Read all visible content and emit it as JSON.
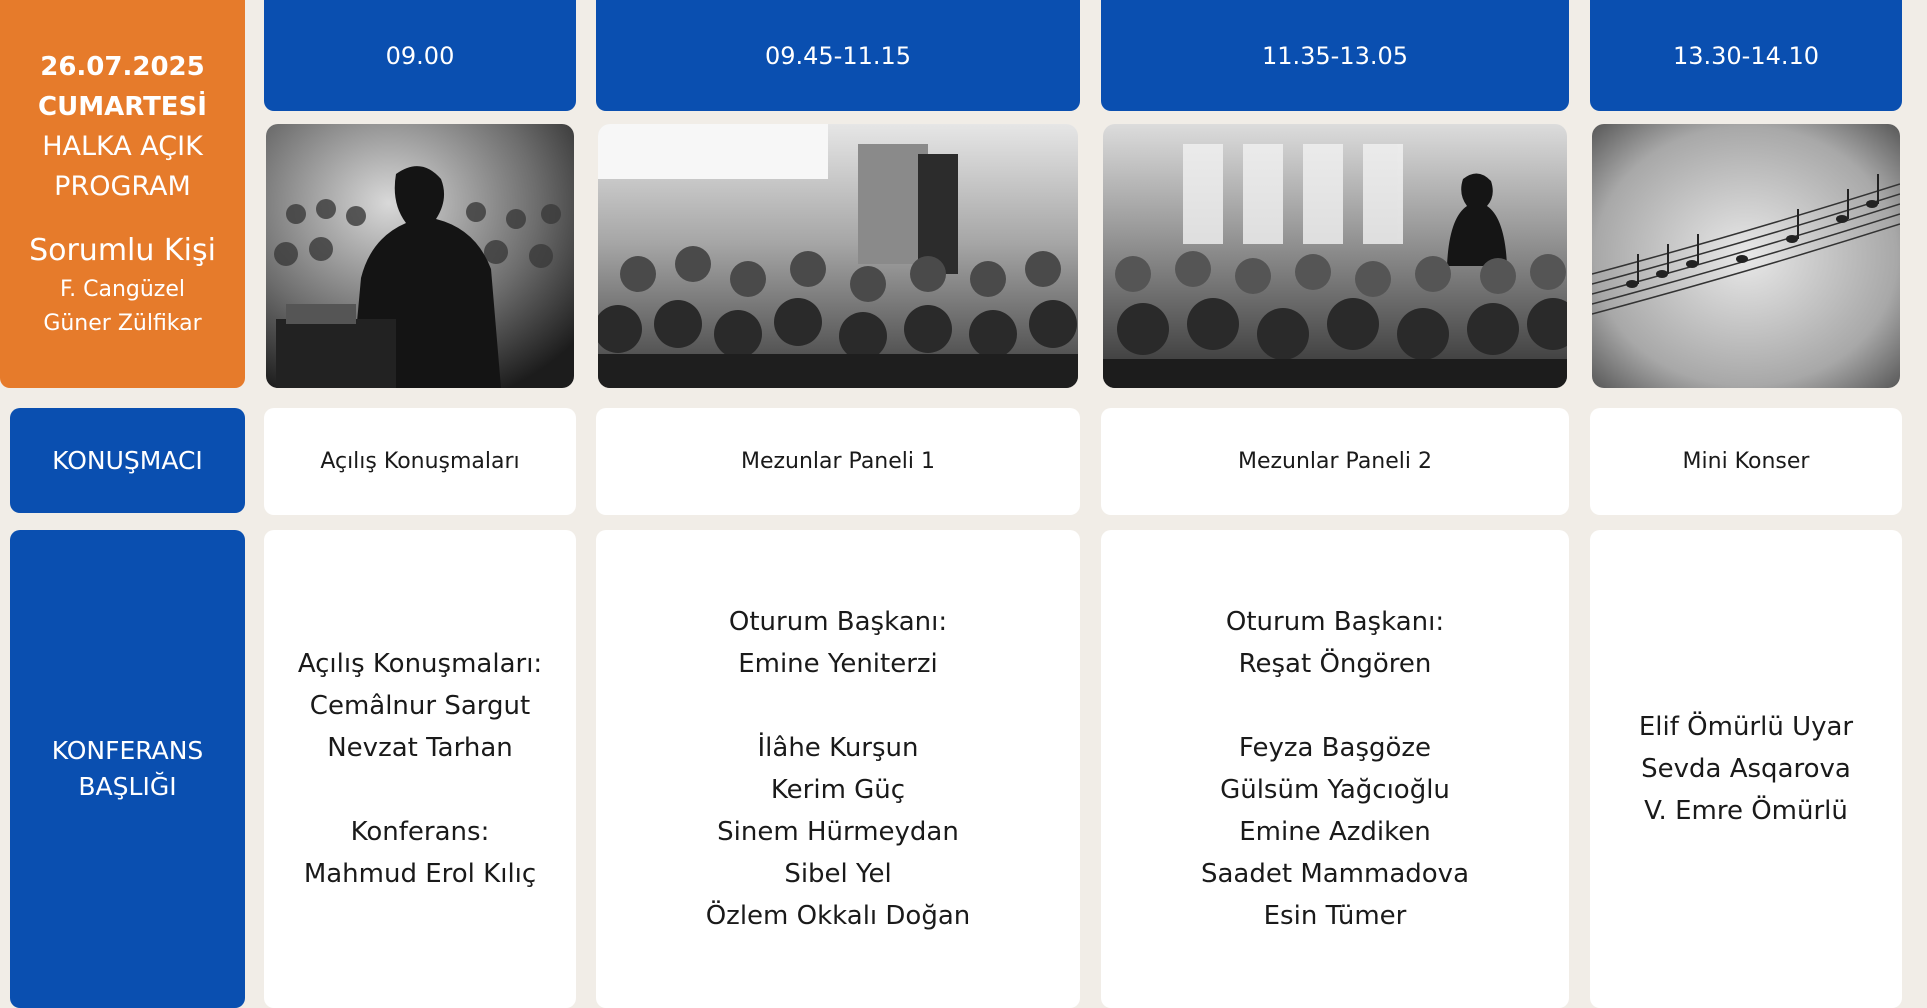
{
  "event": {
    "date": "26.07.2025",
    "day": "CUMARTESİ",
    "program_line1": "HALKA AÇIK",
    "program_line2": "PROGRAM",
    "responsible_label": "Sorumlu Kişi",
    "responsible_people": [
      "F. Cangüzel",
      "Güner Zülfikar"
    ]
  },
  "row_labels": {
    "speaker": "KONUŞMACI",
    "conference_title_line1": "KONFERANS",
    "conference_title_line2": "BAŞLIĞI"
  },
  "columns": [
    {
      "time": "09.00",
      "photo": "speaker-at-podium-photo",
      "session": "Açılış Konuşmaları",
      "lines": [
        "Açılış Konuşmaları:",
        "Cemâlnur Sargut",
        "Nevzat Tarhan",
        "",
        "Konferans:",
        "Mahmud Erol Kılıç"
      ]
    },
    {
      "time": "09.45-11.15",
      "photo": "conference-audience-photo",
      "session": "Mezunlar Paneli 1",
      "lines": [
        "Oturum Başkanı:",
        "Emine Yeniterzi",
        "",
        "İlâhe Kurşun",
        "Kerim Güç",
        "Sinem Hürmeydan",
        "Sibel Yel",
        "Özlem Okkalı Doğan"
      ]
    },
    {
      "time": "11.35-13.05",
      "photo": "seminar-hall-photo",
      "session": "Mezunlar Paneli 2",
      "lines": [
        "Oturum Başkanı:",
        "Reşat Öngören",
        "",
        "Feyza Başgöze",
        "Gülsüm Yağcıoğlu",
        "Emine Azdiken",
        "Saadet Mammadova",
        "Esin Tümer"
      ]
    },
    {
      "time": "13.30-14.10",
      "photo": "sheet-music-photo",
      "session": "Mini Konser",
      "lines": [
        "Elif Ömürlü Uyar",
        "Sevda Asqarova",
        "V. Emre Ömürlü"
      ]
    }
  ],
  "colors": {
    "background": "#f1ede7",
    "orange": "#e67b2b",
    "blue": "#0a4fb0",
    "card": "#ffffff"
  }
}
